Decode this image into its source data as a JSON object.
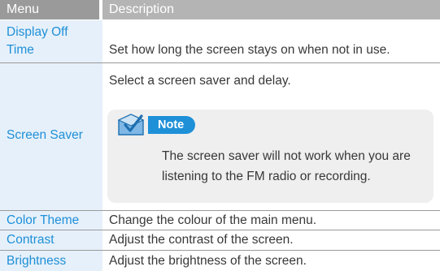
{
  "header": {
    "menu_label": "Menu",
    "description_label": "Description"
  },
  "rows": [
    {
      "menu": "Display Off Time",
      "description": "Set how long the screen stays on when not in use."
    },
    {
      "menu": "Screen Saver",
      "description": "Select a screen saver and delay."
    },
    {
      "menu": "Color Theme",
      "description": "Change the colour of the main menu."
    },
    {
      "menu": "Contrast",
      "description": "Adjust the contrast of the screen."
    },
    {
      "menu": "Brightness",
      "description": "Adjust the brightness of the screen."
    }
  ],
  "note": {
    "label": "Note",
    "icon": "checkbox-note-icon",
    "text": "The screen saver will not work when you are listening to the FM radio or recording."
  },
  "colors": {
    "accent": "#1e90d8",
    "header_bg": "#9a9a9a",
    "header_desc_bg": "#b4b4b4",
    "menu_cell_bg": "#e6f0fa",
    "note_bg": "#efefef"
  }
}
